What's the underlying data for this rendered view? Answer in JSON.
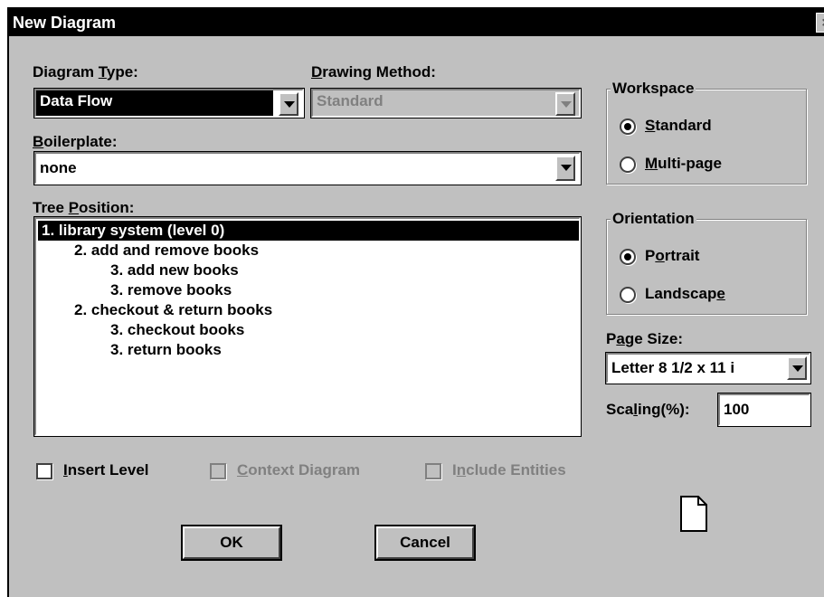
{
  "window": {
    "title": "New Diagram",
    "close_glyph": "×"
  },
  "diagram_type": {
    "label_pre": "Diagram ",
    "label_u": "T",
    "label_post": "ype:",
    "value": "Data Flow"
  },
  "drawing_method": {
    "label_pre": "",
    "label_u": "D",
    "label_post": "rawing Method:",
    "value": "Standard"
  },
  "boilerplate": {
    "label_pre": "",
    "label_u": "B",
    "label_post": "oilerplate:",
    "value": "none"
  },
  "tree_position": {
    "label_pre": "Tree ",
    "label_u": "P",
    "label_post": "osition:",
    "items": [
      {
        "text": "1. library system (level 0)",
        "selected": true
      },
      {
        "text": "2. add and remove books"
      },
      {
        "text": "3. add new books"
      },
      {
        "text": "3. remove books"
      },
      {
        "text": "2. checkout & return books"
      },
      {
        "text": "3. checkout books"
      },
      {
        "text": "3. return books"
      }
    ]
  },
  "workspace": {
    "legend": "Workspace",
    "options": [
      {
        "pre": "",
        "u": "S",
        "post": "tandard",
        "checked": true
      },
      {
        "pre": "",
        "u": "M",
        "post": "ulti-page",
        "checked": false
      }
    ]
  },
  "orientation": {
    "legend": "Orientation",
    "options": [
      {
        "pre": "P",
        "u": "o",
        "post": "rtrait",
        "checked": true
      },
      {
        "pre": "Landscap",
        "u": "e",
        "post": "",
        "checked": false
      }
    ]
  },
  "page_size": {
    "label_pre": "P",
    "label_u": "a",
    "label_post": "ge Size:",
    "value": "Letter 8 1/2 x 11 i"
  },
  "scaling": {
    "label_pre": "Sca",
    "label_u": "l",
    "label_post": "ing(%):",
    "value": "100"
  },
  "checkboxes": [
    {
      "pre": "",
      "u": "I",
      "post": "nsert Level",
      "enabled": true
    },
    {
      "pre": "",
      "u": "C",
      "post": "ontext Diagram",
      "enabled": false
    },
    {
      "pre": "I",
      "u": "n",
      "post": "clude Entities",
      "enabled": false
    }
  ],
  "buttons": {
    "ok": "OK",
    "cancel": "Cancel"
  },
  "page_icon": "page-icon"
}
